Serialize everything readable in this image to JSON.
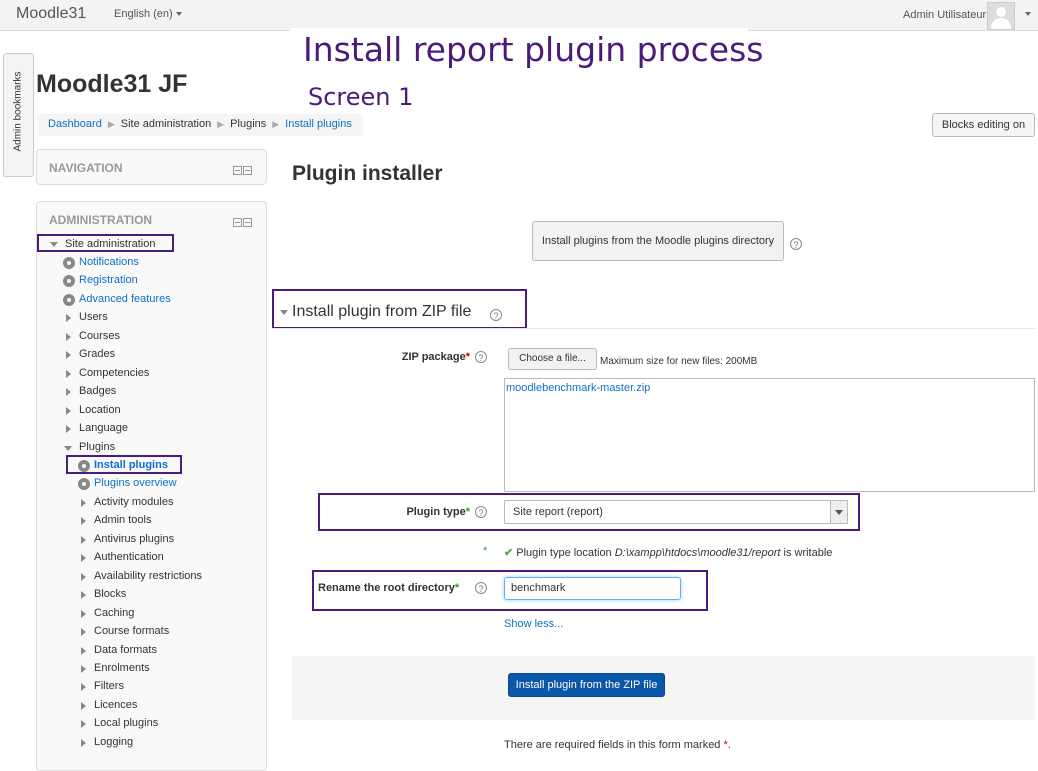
{
  "navbar": {
    "brand": "Moodle31",
    "language": "English (en)",
    "user_name": "Admin Utilisateur"
  },
  "annotation": {
    "title": "Install report plugin process",
    "subtitle": "Screen 1"
  },
  "bookmarks_tab": "Admin bookmarks",
  "site_title": "Moodle31 JF",
  "breadcrumb": [
    "Dashboard",
    "Site administration",
    "Plugins",
    "Install plugins"
  ],
  "blocks_editing_button": "Blocks editing on",
  "navigation_block": {
    "title": "NAVIGATION"
  },
  "administration_block": {
    "title": "ADMINISTRATION",
    "site_admin": "Site administration",
    "items": [
      {
        "label": "Notifications",
        "icon": "gear",
        "link": true
      },
      {
        "label": "Registration",
        "icon": "gear",
        "link": true
      },
      {
        "label": "Advanced features",
        "icon": "gear",
        "link": true
      },
      {
        "label": "Users",
        "icon": "arrow-right",
        "link": false
      },
      {
        "label": "Courses",
        "icon": "arrow-right",
        "link": false
      },
      {
        "label": "Grades",
        "icon": "arrow-right",
        "link": false
      },
      {
        "label": "Competencies",
        "icon": "arrow-right",
        "link": false
      },
      {
        "label": "Badges",
        "icon": "arrow-right",
        "link": false
      },
      {
        "label": "Location",
        "icon": "arrow-right",
        "link": false
      },
      {
        "label": "Language",
        "icon": "arrow-right",
        "link": false
      },
      {
        "label": "Plugins",
        "icon": "arrow-down",
        "link": false
      }
    ],
    "plugin_items": [
      {
        "label": "Install plugins",
        "icon": "gear",
        "link": true,
        "active": true
      },
      {
        "label": "Plugins overview",
        "icon": "gear",
        "link": true
      },
      {
        "label": "Activity modules",
        "icon": "arrow-right",
        "link": false
      },
      {
        "label": "Admin tools",
        "icon": "arrow-right",
        "link": false
      },
      {
        "label": "Antivirus plugins",
        "icon": "arrow-right",
        "link": false
      },
      {
        "label": "Authentication",
        "icon": "arrow-right",
        "link": false
      },
      {
        "label": "Availability restrictions",
        "icon": "arrow-right",
        "link": false
      },
      {
        "label": "Blocks",
        "icon": "arrow-right",
        "link": false
      },
      {
        "label": "Caching",
        "icon": "arrow-right",
        "link": false
      },
      {
        "label": "Course formats",
        "icon": "arrow-right",
        "link": false
      },
      {
        "label": "Data formats",
        "icon": "arrow-right",
        "link": false
      },
      {
        "label": "Enrolments",
        "icon": "arrow-right",
        "link": false
      },
      {
        "label": "Filters",
        "icon": "arrow-right",
        "link": false
      },
      {
        "label": "Licences",
        "icon": "arrow-right",
        "link": false
      },
      {
        "label": "Local plugins",
        "icon": "arrow-right",
        "link": false
      },
      {
        "label": "Logging",
        "icon": "arrow-right",
        "link": false
      }
    ]
  },
  "main": {
    "heading": "Plugin installer",
    "directory_button": "Install plugins from the Moodle plugins directory",
    "zip_section": "Install plugin from ZIP file",
    "zip_package_label": "ZIP package",
    "choose_file_button": "Choose a file...",
    "max_size": "Maximum size for new files: 200MB",
    "uploaded_file": "moodlebenchmark-master.zip",
    "plugin_type_label": "Plugin type",
    "plugin_type_value": "Site report (report)",
    "location_prefix": "Plugin type location ",
    "location_path": "D:\\xampp\\htdocs\\moodle31/report",
    "location_suffix": " is writable",
    "rename_label": "Rename the root directory",
    "rename_value": "benchmark",
    "show_less": "Show less...",
    "submit_button": "Install plugin from the ZIP file",
    "required_note": "There are required fields in this form marked",
    "required_star": "*",
    "required_period": "."
  },
  "colors": {
    "annotation": "#4b1a7a",
    "link": "#0f6fc5",
    "primary_button": "#0a56a8"
  }
}
